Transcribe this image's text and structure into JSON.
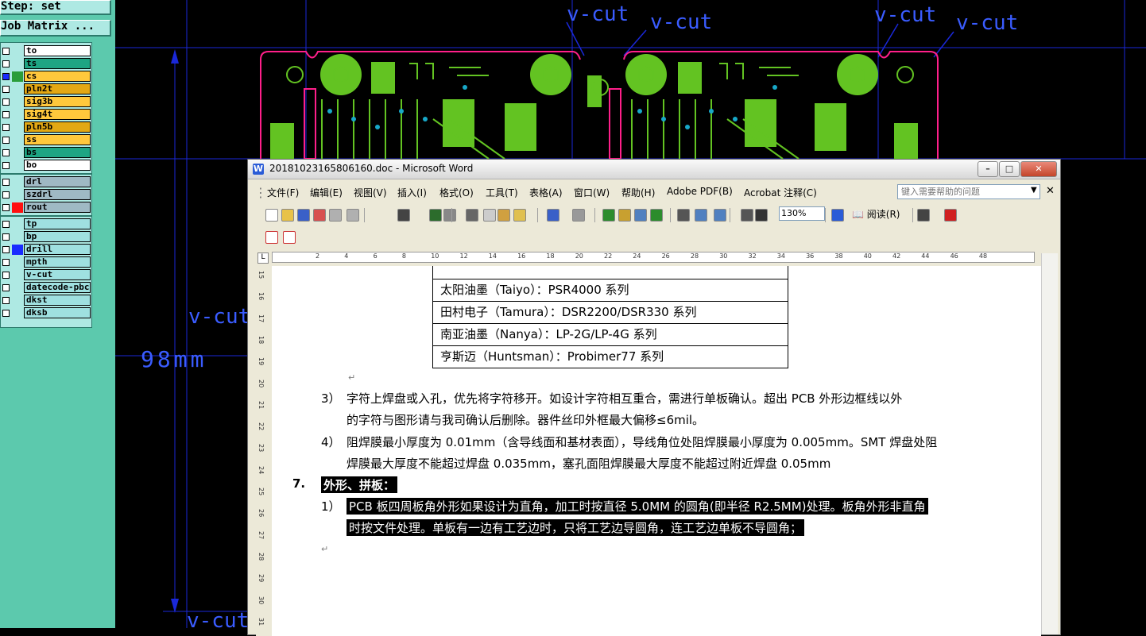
{
  "cam": {
    "step_label": "Step: set",
    "job_matrix_label": "Job Matrix ...",
    "layers": [
      {
        "name": "to",
        "color": "#ffffff",
        "swatch": "none"
      },
      {
        "name": "ts",
        "color": "#1ea583",
        "swatch": "none"
      },
      {
        "name": "cs",
        "color": "#ffc83c",
        "swatch": "#2a9d3a",
        "checked": true
      },
      {
        "name": "pln2t",
        "color": "#e3a814",
        "swatch": "none"
      },
      {
        "name": "sig3b",
        "color": "#ffc83c",
        "swatch": "none"
      },
      {
        "name": "sig4t",
        "color": "#ffc83c",
        "swatch": "none"
      },
      {
        "name": "pln5b",
        "color": "#e3a814",
        "swatch": "none"
      },
      {
        "name": "ss",
        "color": "#ffc83c",
        "swatch": "none"
      },
      {
        "name": "bs",
        "color": "#1ea583",
        "swatch": "none"
      },
      {
        "name": "bo",
        "color": "#ffffff",
        "swatch": "none"
      },
      {
        "name": "drl",
        "color": "#9fb9c4",
        "swatch": "none"
      },
      {
        "name": "szdrl",
        "color": "#9fb9c4",
        "swatch": "none"
      },
      {
        "name": "rout",
        "color": "#9fb9c4",
        "swatch": "#ff1010"
      },
      {
        "name": "tp",
        "color": "#9fe0e0",
        "swatch": "none"
      },
      {
        "name": "bp",
        "color": "#9fe0e0",
        "swatch": "none"
      },
      {
        "name": "drill",
        "color": "#9fe0e0",
        "swatch": "#1a2cff"
      },
      {
        "name": "mpth",
        "color": "#9fe0e0",
        "swatch": "none"
      },
      {
        "name": "v-cut",
        "color": "#9fe0e0",
        "swatch": "none"
      },
      {
        "name": "datecode-pbc",
        "color": "#9fe0e0",
        "swatch": "none"
      },
      {
        "name": "dkst",
        "color": "#9fe0e0",
        "swatch": "none"
      },
      {
        "name": "dksb",
        "color": "#9fe0e0",
        "swatch": "none"
      }
    ],
    "annotations": {
      "vcut": "v-cut",
      "dimension": "98mm"
    }
  },
  "word": {
    "title": "20181023165806160.doc - Microsoft Word",
    "menus": [
      "文件(F)",
      "编辑(E)",
      "视图(V)",
      "插入(I)",
      "格式(O)",
      "工具(T)",
      "表格(A)",
      "窗口(W)",
      "帮助(H)",
      "Adobe PDF(B)",
      "Acrobat 注释(C)"
    ],
    "help_placeholder": "键入需要帮助的问题",
    "zoom": "130%",
    "read_label": "阅读(R)",
    "ruler_labels": [
      "2",
      "4",
      "6",
      "8",
      "10",
      "12",
      "14",
      "16",
      "18",
      "20",
      "22",
      "24",
      "26",
      "28",
      "30",
      "32",
      "34",
      "36",
      "38",
      "40",
      "42",
      "44",
      "46",
      "48"
    ],
    "vruler_labels": [
      "15",
      "16",
      "17",
      "18",
      "19",
      "20",
      "21",
      "22",
      "23",
      "24",
      "25",
      "26",
      "27",
      "28",
      "29",
      "30",
      "31"
    ],
    "table_rows": [
      "太阳油墨（Taiyo）：PSR4000 系列",
      "田村电子（Tamura）：DSR2200/DSR330 系列",
      "南亚油墨（Nanya）：LP-2G/LP-4G 系列",
      "亨斯迈（Huntsman）：Probimer77 系列"
    ],
    "p3_num": "3）",
    "p3_line1": "字符上焊盘或入孔，优先将字符移开。如设计字符相互重合，需进行单板确认。超出 PCB 外形边框线以外",
    "p3_line2": "的字符与图形请与我司确认后删除。器件丝印外框最大偏移≤6mil。",
    "p4_num": "4）",
    "p4_line1": "阻焊膜最小厚度为 0.01mm（含导线面和基材表面），导线角位处阻焊膜最小厚度为 0.005mm。SMT 焊盘处阻",
    "p4_line2": "焊膜最大厚度不能超过焊盘 0.035mm，塞孔面阻焊膜最大厚度不能超过附近焊盘 0.05mm",
    "h7_num": "7.",
    "h7_text": "外形、拼板：",
    "p1_num": "1）",
    "p1_line1": "PCB 板四周板角外形如果设计为直角，加工时按直径 5.0MM 的圆角(即半径 R2.5MM)处理。板角外形非直角",
    "p1_line2": "时按文件处理。单板有一边有工艺边时，只将工艺边导圆角，连工艺边单板不导圆角；"
  }
}
